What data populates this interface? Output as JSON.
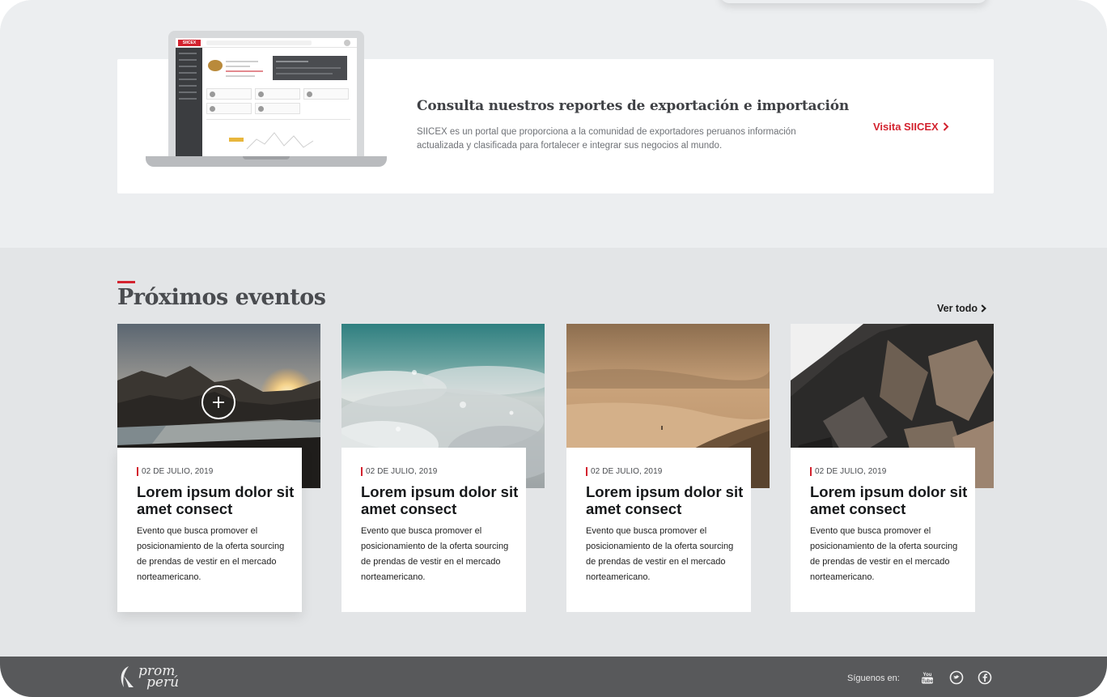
{
  "siicex": {
    "title": "Consulta nuestros reportes de exportación e importación",
    "description": "SIICEX es un portal que proporciona a la comunidad de exportadores peruanos información actualizada y clasificada para fortalecer e integrar sus negocios al mundo.",
    "link_label": "Visita SIICEX",
    "screen_logo": "SIICEX"
  },
  "events": {
    "title": "Próximos eventos",
    "see_all_label": "Ver todo",
    "items": [
      {
        "date": "02 DE JULIO, 2019",
        "title": "Lorem ipsum dolor sit amet consect",
        "description": "Evento que busca promover el posicionamiento de la oferta sourcing de prendas de vestir en el mercado norteamericano.",
        "image": "mountain-lake-sunset"
      },
      {
        "date": "02 DE JULIO, 2019",
        "title": "Lorem ipsum dolor sit amet consect",
        "description": "Evento que busca promover el posicionamiento de la oferta sourcing de prendas de vestir en el mercado norteamericano.",
        "image": "sea-foam"
      },
      {
        "date": "02 DE JULIO, 2019",
        "title": "Lorem ipsum dolor sit amet consect",
        "description": "Evento que busca promover el posicionamiento de la oferta sourcing de prendas de vestir en el mercado norteamericano.",
        "image": "desert-dunes"
      },
      {
        "date": "02 DE JULIO, 2019",
        "title": "Lorem ipsum dolor sit amet consect",
        "description": "Evento que busca promover el posicionamiento de la oferta sourcing de prendas de vestir en el mercado norteamericano.",
        "image": "dark-rocks"
      }
    ]
  },
  "footer": {
    "logo_line1": "prom",
    "logo_line2": "perú",
    "social_label": "Síguenos en:",
    "social_icons": [
      "youtube-icon",
      "twitter-icon",
      "facebook-icon"
    ]
  },
  "colors": {
    "accent": "#d3232f",
    "footer_bg": "#58595b",
    "page_bg": "#eceef0",
    "events_bg": "#e3e5e7"
  }
}
